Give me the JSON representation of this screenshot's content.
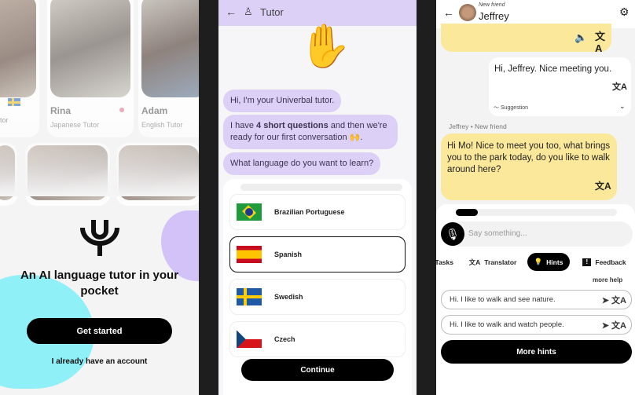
{
  "welcome": {
    "tutors": [
      {
        "name": "",
        "role": "tor",
        "flag": "sweden"
      },
      {
        "name": "Rina",
        "role": "Japanese Tutor",
        "flag": "japan"
      },
      {
        "name": "Adam",
        "role": "English Tutor"
      }
    ],
    "tagline": "An AI language tutor in your pocket",
    "get_started": "Get started",
    "login": "I already have an account",
    "colors": {
      "blob_cyan": "#8ff0f7",
      "blob_purple": "#d2c2f8"
    }
  },
  "onboarding": {
    "header_title": "Tutor",
    "icons": {
      "back": "arrow-left-icon",
      "bot": "robot-icon",
      "wave": "raised-hand-emoji"
    },
    "messages": {
      "m1": "Hi, I'm your Univerbal tutor.",
      "m2_pre": "I have ",
      "m2_bold": "4 short questions",
      "m2_post": " and then we're ready for our first conversation 🙌.",
      "m3": "What language do you want to learn?"
    },
    "languages": [
      {
        "label": "Brazilian Portuguese",
        "selected": false
      },
      {
        "label": "Spanish",
        "selected": true
      },
      {
        "label": "Swedish",
        "selected": false
      },
      {
        "label": "Czech",
        "selected": false
      }
    ],
    "continue": "Continue",
    "accent": "#ddd0f7"
  },
  "chat": {
    "contact_status": "New friend",
    "contact_name": "Jeffrey",
    "user_message": "Hi, Jeffrey. Nice meeting you.",
    "suggestion_label": "Suggestion",
    "sender_meta": "Jeffrey • New friend",
    "friend_message": "Hi Mo! Nice to meet you too, what brings you to the park today, do you like to walk around here?",
    "input_placeholder": "Say something...",
    "chips": {
      "tasks": "Tasks",
      "translator": "Translator",
      "hints": "Hints",
      "feedback": "Feedback"
    },
    "more_help": "more help",
    "hints": [
      "Hi. I like to walk and see nature.",
      "Hi. I like to walk and watch people."
    ],
    "more_hints": "More hints",
    "accent": "#fbe89a"
  }
}
